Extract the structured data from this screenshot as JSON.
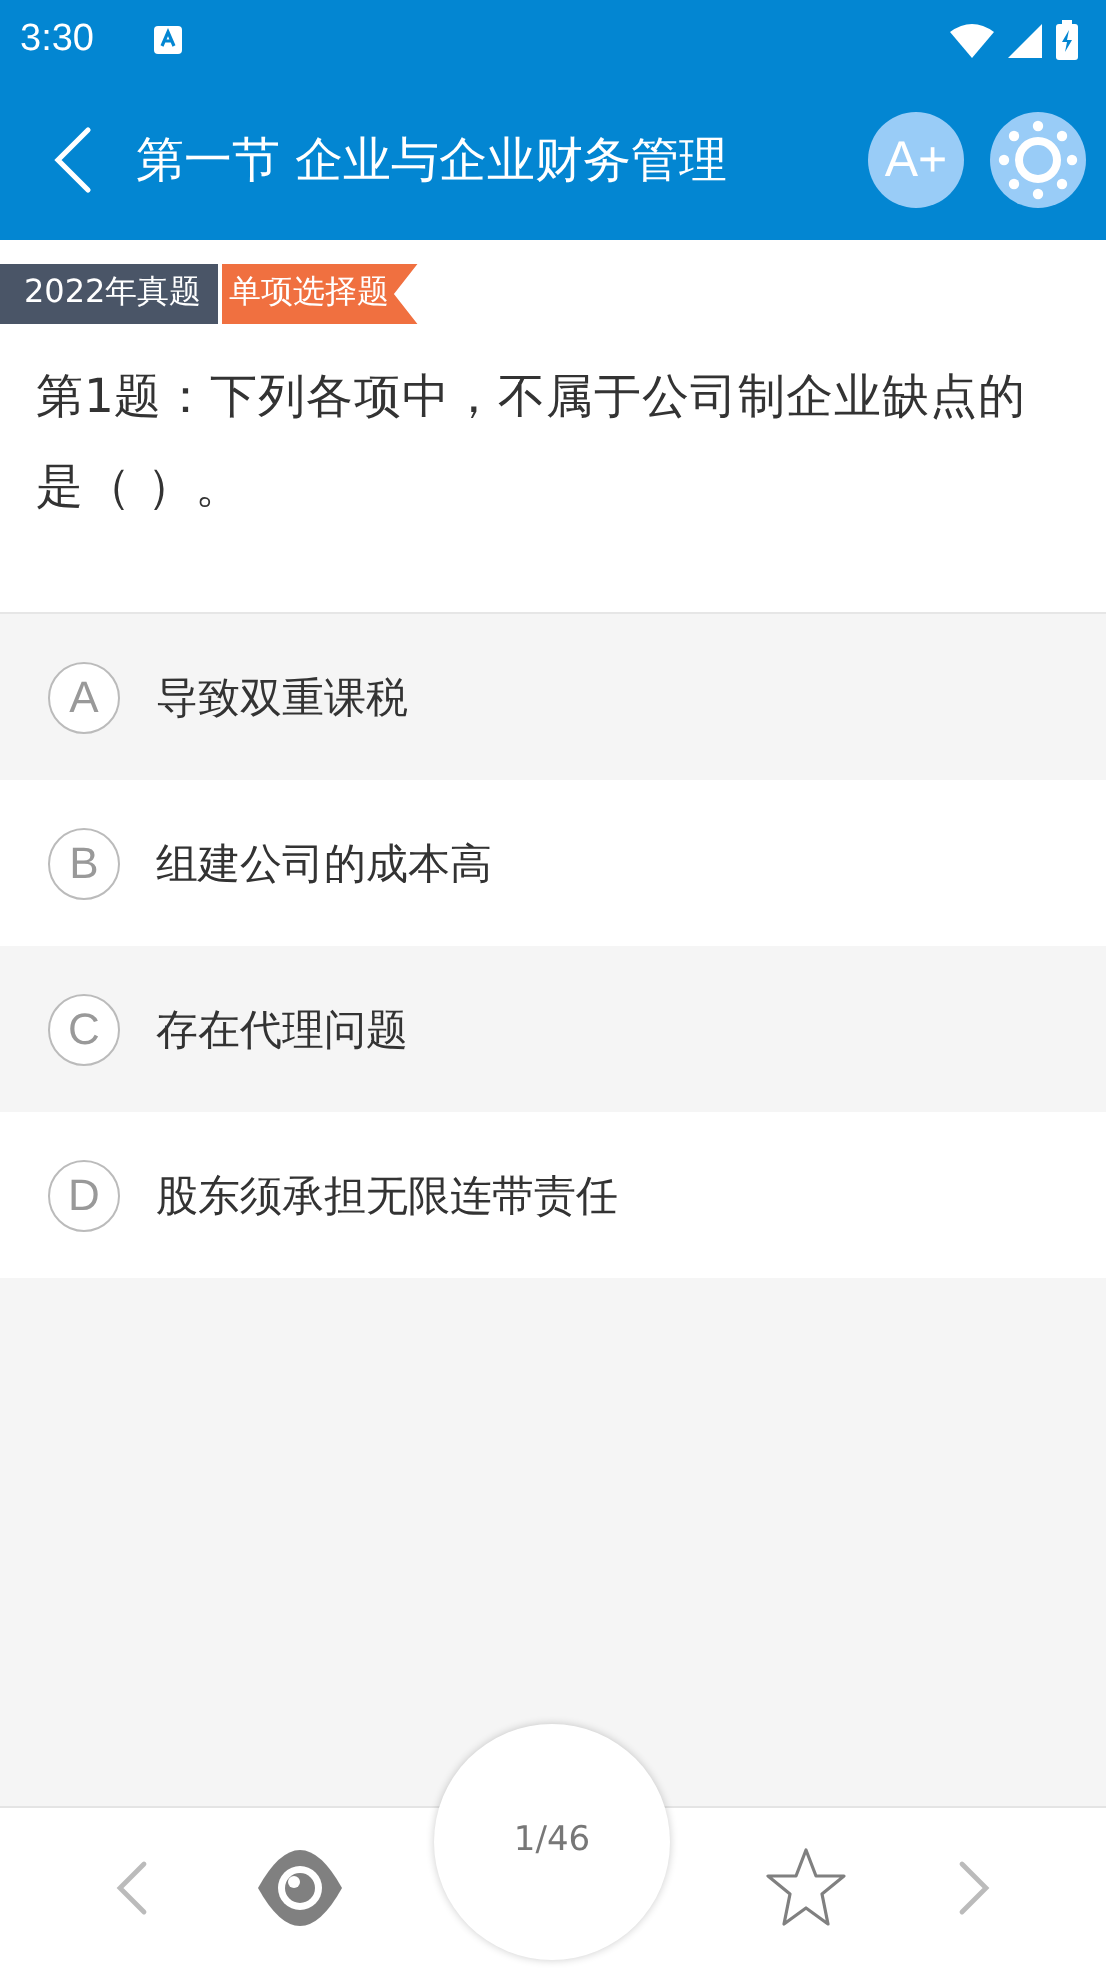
{
  "status_bar": {
    "time": "3:30"
  },
  "header": {
    "title": "第一节 企业与企业财务管理",
    "font_button": "A+"
  },
  "tags": [
    {
      "kind": "year",
      "label": "2022年真题"
    },
    {
      "kind": "type",
      "label": "单项选择题"
    }
  ],
  "question": "第1题：下列各项中，不属于公司制企业缺点的是（ ）。",
  "options": [
    {
      "letter": "A",
      "text": "导致双重课税"
    },
    {
      "letter": "B",
      "text": "组建公司的成本高"
    },
    {
      "letter": "C",
      "text": "存在代理问题"
    },
    {
      "letter": "D",
      "text": "股东须承担无限连带责任"
    }
  ],
  "bottom_bar": {
    "progress": "1/46"
  }
}
